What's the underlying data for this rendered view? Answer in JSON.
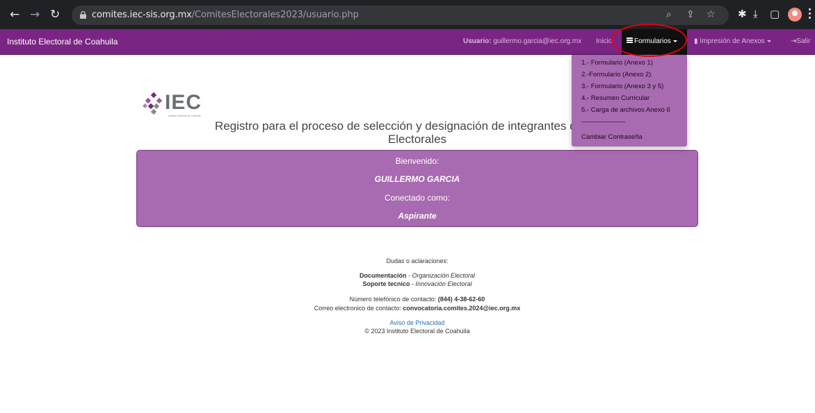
{
  "browser": {
    "back_icon": "arrow-left-icon",
    "forward_icon": "arrow-right-icon",
    "reload_icon": "reload-icon",
    "url_host": "comites.iec-sis.org.mx",
    "url_path": "/ComitesElectorales2023/usuario.php"
  },
  "navbar": {
    "brand": "Instituto Electoral de Coahuila",
    "user_label": "Usuario:",
    "user_email": "guillermo.garcia@iec.org.mx",
    "inicio": "Inicio",
    "formularios": "Formularios",
    "impresion": "Impresión de Anexos",
    "salir": "Salir",
    "bg_color": "#7a2584"
  },
  "dropdown": {
    "items": [
      "1.- Formulario (Anexo 1)",
      "2.-Formulario (Anexo 2)",
      "3.- Formulario (Anexo 3 y 5)",
      "4.- Resumen Curricular",
      "5.- Carga de archivos Anexo 6"
    ],
    "separator": "-----------------------------",
    "change_password": "Cambiar Contraseña"
  },
  "logo": {
    "text": "IEC",
    "subtitle": "Instituto Electoral de Coahuila"
  },
  "page": {
    "title_line1": "Registro para el proceso de selección y designación de integrantes de los Co",
    "title_line2": "Electorales"
  },
  "welcome": {
    "greeting": "Bienvenido:",
    "name": "GUILLERMO GARCIA",
    "connected_as": "Conectado como:",
    "role": "Aspirante"
  },
  "footer": {
    "dudas": "Dudas o aclaraciones:",
    "doc_label": "Documentación",
    "doc_area": "Organización Electoral",
    "soporte_label": "Soporte tecnico",
    "soporte_area": "Innovación Electoral",
    "phone_label": "Número telefónico de contacto:",
    "phone": "(844) 4-38-62-60",
    "email_label": "Correo electronico de contacto:",
    "email": "convocatoria.comites.2024@iec.org.mx",
    "privacy": "Aviso de Privacidad",
    "copyright": "© 2023 Instituto Electoral de Coahuila"
  }
}
